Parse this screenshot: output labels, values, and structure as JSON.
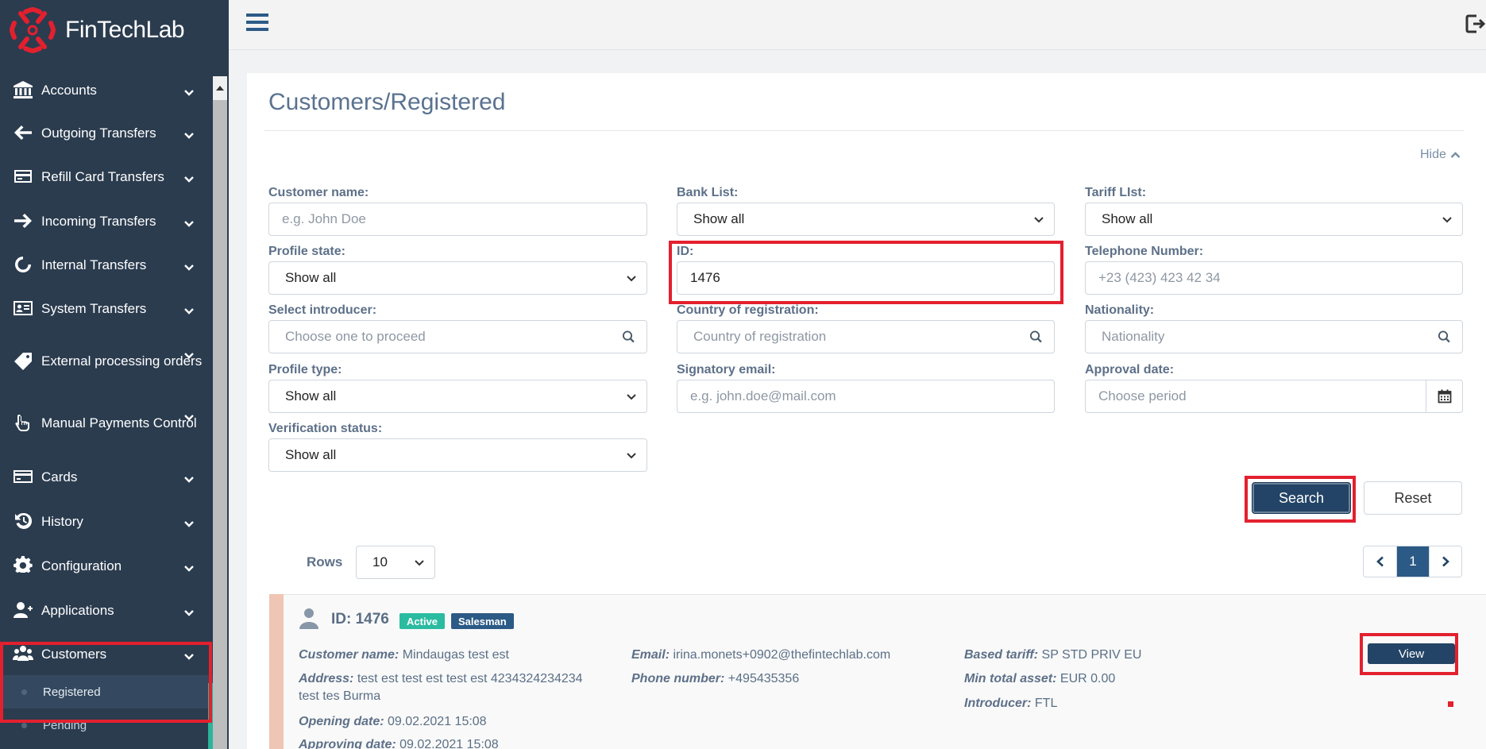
{
  "brand": {
    "name": "FinTechLab",
    "logo_color": "#e3202e"
  },
  "sidebar": {
    "items": [
      {
        "label": "Accounts",
        "icon": "bank-icon"
      },
      {
        "label": "Outgoing Transfers",
        "icon": "arrow-left-icon"
      },
      {
        "label": "Refill Card Transfers",
        "icon": "card-refill-icon"
      },
      {
        "label": "Incoming Transfers",
        "icon": "arrow-right-icon"
      },
      {
        "label": "Internal Transfers",
        "icon": "circle-arrows-icon"
      },
      {
        "label": "System Transfers",
        "icon": "id-card-icon"
      },
      {
        "label": "External processing orders",
        "icon": "tag-icon"
      },
      {
        "label": "Manual Payments Control",
        "icon": "hand-pointer-icon"
      },
      {
        "label": "Cards",
        "icon": "credit-card-icon"
      },
      {
        "label": "History",
        "icon": "history-icon"
      },
      {
        "label": "Configuration",
        "icon": "gear-icon"
      },
      {
        "label": "Applications",
        "icon": "user-plus-icon"
      },
      {
        "label": "Customers",
        "icon": "users-icon"
      }
    ],
    "customers_sub": [
      {
        "label": "Registered"
      },
      {
        "label": "Pending"
      }
    ]
  },
  "page": {
    "title": "Customers/Registered",
    "hide_label": "Hide"
  },
  "filters": {
    "customer_name": {
      "label": "Customer name:",
      "placeholder": "e.g. John Doe"
    },
    "bank_list": {
      "label": "Bank List:",
      "value": "Show all"
    },
    "tariff_list": {
      "label": "Tariff LIst:",
      "value": "Show all"
    },
    "profile_state": {
      "label": "Profile state:",
      "value": "Show all"
    },
    "id": {
      "label": "ID:",
      "value": "1476"
    },
    "telephone": {
      "label": "Telephone Number:",
      "placeholder": "+23 (423) 423 42 34"
    },
    "introducer": {
      "label": "Select introducer:",
      "placeholder": "Choose one to proceed"
    },
    "country": {
      "label": "Country of registration:",
      "placeholder": "Country of registration"
    },
    "nationality": {
      "label": "Nationality:",
      "placeholder": "Nationality"
    },
    "profile_type": {
      "label": "Profile type:",
      "value": "Show all"
    },
    "signatory_email": {
      "label": "Signatory email:",
      "placeholder": "e.g. john.doe@mail.com"
    },
    "approval_date": {
      "label": "Approval date:",
      "placeholder": "Choose period"
    },
    "verification_status": {
      "label": "Verification status:",
      "value": "Show all"
    }
  },
  "actions": {
    "search_label": "Search",
    "reset_label": "Reset"
  },
  "pagination": {
    "rows_label": "Rows",
    "rows_value": "10",
    "current_page": "1"
  },
  "result": {
    "id_text": "ID: 1476",
    "badges": {
      "active": "Active",
      "role": "Salesman"
    },
    "customer_name": {
      "k": "Customer name:",
      "v": "Mindaugas test est"
    },
    "address": {
      "k": "Address:",
      "v": "test est test est test est 4234324234234 test tes Burma"
    },
    "opening_date": {
      "k": "Opening date:",
      "v": "09.02.2021 15:08"
    },
    "approving_date": {
      "k": "Approving date:",
      "v": "09.02.2021 15:08"
    },
    "email": {
      "k": "Email:",
      "v": "irina.monets+0902@thefintechlab.com"
    },
    "phone": {
      "k": "Phone number:",
      "v": "+495435356"
    },
    "based_tariff": {
      "k": "Based tariff:",
      "v": "SP STD PRIV EU"
    },
    "min_total_asset": {
      "k": "Min total asset:",
      "v": "EUR 0.00"
    },
    "introducer": {
      "k": "Introducer:",
      "v": "FTL"
    },
    "view_label": "View"
  }
}
